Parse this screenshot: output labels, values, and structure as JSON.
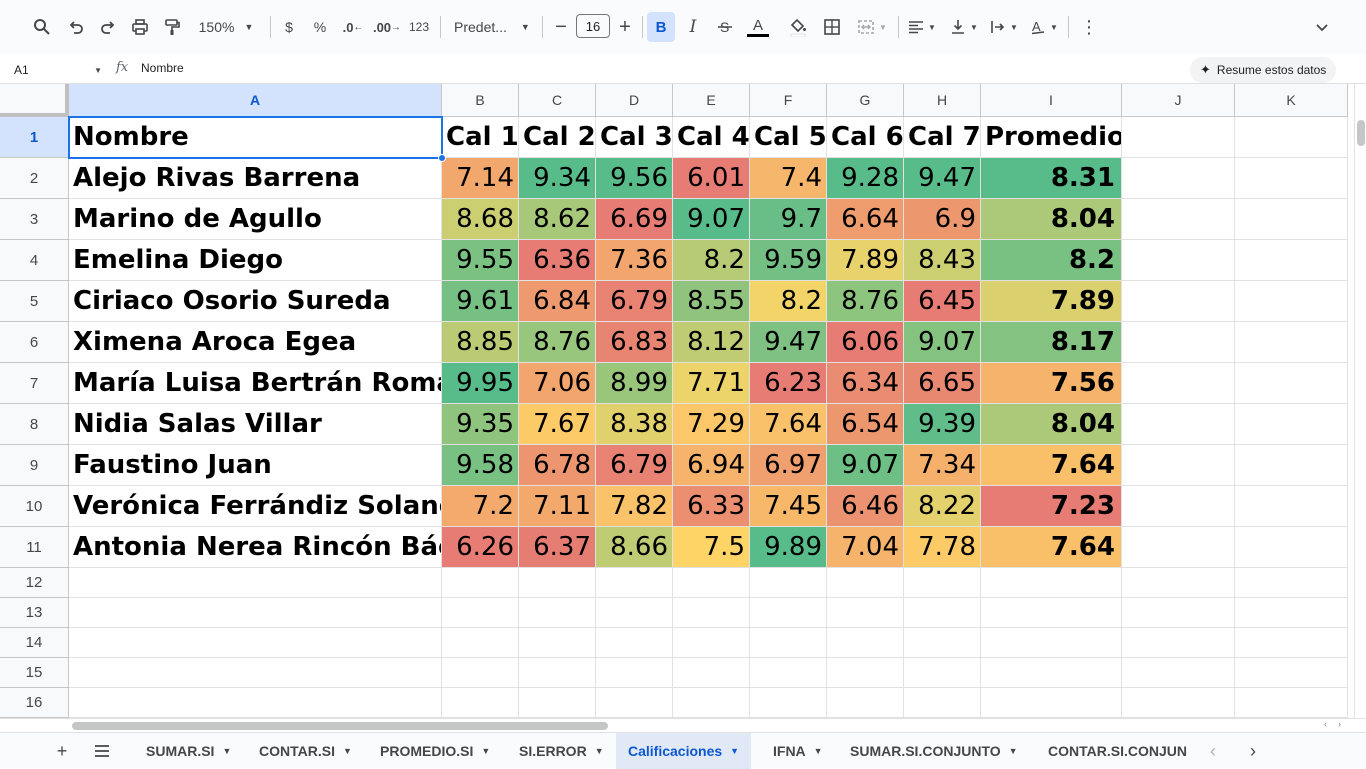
{
  "toolbar": {
    "zoom": "150%",
    "currency": "$",
    "percent": "%",
    "decrease_decimals": ".0",
    "increase_decimals": ".00",
    "number_format": "123",
    "font_name": "Predet...",
    "font_size": "16",
    "bold": "B",
    "italic": "I",
    "text_color": "A"
  },
  "formula_bar": {
    "cell_ref": "A1",
    "fx": "fx",
    "formula": "Nombre",
    "summarize_label": "Resume estos datos"
  },
  "columns": [
    "A",
    "B",
    "C",
    "D",
    "E",
    "F",
    "G",
    "H",
    "I",
    "J",
    "K"
  ],
  "rows": [
    "1",
    "2",
    "3",
    "4",
    "5",
    "6",
    "7",
    "8",
    "9",
    "10",
    "11",
    "12",
    "13",
    "14",
    "15",
    "16"
  ],
  "table": {
    "headers": [
      "Nombre",
      "Cal 1",
      "Cal 2",
      "Cal 3",
      "Cal 4",
      "Cal 5",
      "Cal 6",
      "Cal 7",
      "Promedio"
    ],
    "records": [
      {
        "name": "Alejo Rivas Barrena",
        "scores": [
          "7.14",
          "9.34",
          "9.56",
          "6.01",
          "7.4",
          "9.28",
          "9.47"
        ],
        "avg": "8.31"
      },
      {
        "name": "Marino de Agullo",
        "scores": [
          "8.68",
          "8.62",
          "6.69",
          "9.07",
          "9.7",
          "6.64",
          "6.9"
        ],
        "avg": "8.04"
      },
      {
        "name": "Emelina Diego",
        "scores": [
          "9.55",
          "6.36",
          "7.36",
          "8.2",
          "9.59",
          "7.89",
          "8.43"
        ],
        "avg": "8.2"
      },
      {
        "name": "Ciriaco Osorio Sureda",
        "scores": [
          "9.61",
          "6.84",
          "6.79",
          "8.55",
          "8.2",
          "8.76",
          "6.45"
        ],
        "avg": "7.89"
      },
      {
        "name": "Ximena Aroca Egea",
        "scores": [
          "8.85",
          "8.76",
          "6.83",
          "8.12",
          "9.47",
          "6.06",
          "9.07"
        ],
        "avg": "8.17"
      },
      {
        "name": "María Luisa Bertrán Roman",
        "scores": [
          "9.95",
          "7.06",
          "8.99",
          "7.71",
          "6.23",
          "6.34",
          "6.65"
        ],
        "avg": "7.56"
      },
      {
        "name": "Nidia Salas Villar",
        "scores": [
          "9.35",
          "7.67",
          "8.38",
          "7.29",
          "7.64",
          "6.54",
          "9.39"
        ],
        "avg": "8.04"
      },
      {
        "name": "Faustino Juan",
        "scores": [
          "9.58",
          "6.78",
          "6.79",
          "6.94",
          "6.97",
          "9.07",
          "7.34"
        ],
        "avg": "7.64"
      },
      {
        "name": "Verónica Ferrándiz Solano",
        "scores": [
          "7.2",
          "7.11",
          "7.82",
          "6.33",
          "7.45",
          "6.46",
          "8.22"
        ],
        "avg": "7.23"
      },
      {
        "name": "Antonia Nerea Rincón Báez",
        "scores": [
          "6.26",
          "6.37",
          "8.66",
          "7.5",
          "9.89",
          "7.04",
          "7.78"
        ],
        "avg": "7.64"
      }
    ]
  },
  "colors": {
    "scale_low": "#e67c73",
    "scale_mid": "#ffd666",
    "scale_high": "#57bb8a",
    "selection": "#1a73e8",
    "header_selected_bg": "#d3e3fd"
  },
  "sheets": [
    {
      "label": "SUMAR.SI",
      "active": false
    },
    {
      "label": "CONTAR.SI",
      "active": false
    },
    {
      "label": "PROMEDIO.SI",
      "active": false
    },
    {
      "label": "SI.ERROR",
      "active": false
    },
    {
      "label": "Calificaciones",
      "active": true
    },
    {
      "label": "IFNA",
      "active": false
    },
    {
      "label": "SUMAR.SI.CONJUNTO",
      "active": false
    },
    {
      "label": "CONTAR.SI.CONJUN",
      "active": false
    }
  ]
}
